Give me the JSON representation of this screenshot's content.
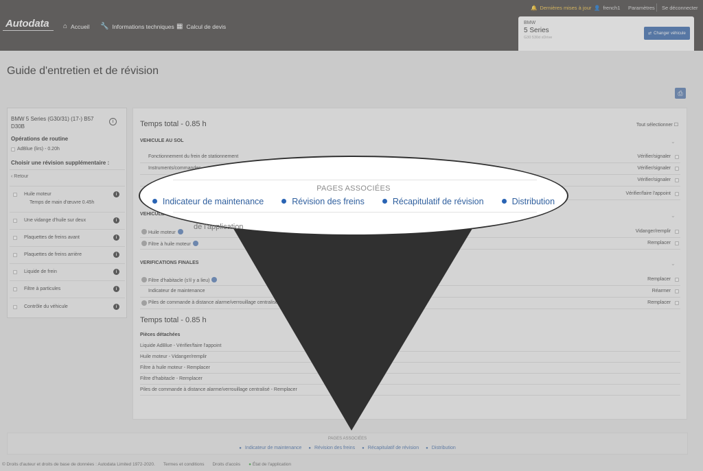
{
  "header": {
    "brand": "Autodata",
    "nav": [
      {
        "label": "Accueil",
        "icon": "home-icon"
      },
      {
        "label": "Informations techniques",
        "icon": "wrench-icon"
      },
      {
        "label": "Calcul de devis",
        "icon": "calculator-icon"
      }
    ],
    "updates": "Dernières mises à jour",
    "user": "french1",
    "settings": "Paramètres",
    "logout": "Se déconnecter"
  },
  "vehicle": {
    "make": "BMW",
    "model": "5 Series",
    "sub": "G30 530d xDrive",
    "change_label": "Changer véhicule"
  },
  "page": {
    "title": "Guide d'entretien et de révision"
  },
  "sidebar": {
    "vehicle": "BMW 5 Series (G30/31) (17-) B57 D30B",
    "routine_heading": "Opérations de routine",
    "routine_item": "AdBlue (lirs) - 0.20h",
    "extra_heading": "Choisir une révision supplémentaire :",
    "back": "Retour",
    "items": [
      {
        "label": "Huile moteur",
        "detail": "Temps de main d'œuvre 0.45h"
      },
      {
        "label": "Une vidange d'huile sur deux"
      },
      {
        "label": "Plaquettes de freins avant"
      },
      {
        "label": "Plaquettes de freins arrière"
      },
      {
        "label": "Liquide de frein"
      },
      {
        "label": "Filtre à particules"
      },
      {
        "label": "Contrôle du véhicule"
      }
    ]
  },
  "main": {
    "total_top": "Temps total - 0.85 h",
    "select_all": "Tout sélectionner",
    "sections": [
      {
        "title": "VEHICULE AU SOL",
        "rows": [
          {
            "label": "Fonctionnement du frein de stationnement",
            "action": "Vérifier/signaler"
          },
          {
            "label": "Instruments/commandes",
            "action": "Vérifier/signaler"
          },
          {
            "label": "",
            "action": "Vérifier/signaler"
          },
          {
            "label": "",
            "action": "Vérifier/faire l'appoint"
          }
        ]
      },
      {
        "title": "VEHICULE",
        "rows": [
          {
            "label": "Huile moteur",
            "action": "Vidanger/remplir"
          },
          {
            "label": "Filtre à huile moteur",
            "action": "Remplacer"
          }
        ]
      },
      {
        "title": "VERIFICATIONS FINALES",
        "rows": [
          {
            "label": "Filtre d'habitacle (s'il y a lieu)",
            "action": "Remplacer"
          },
          {
            "label": "Indicateur de maintenance",
            "action": "Réarmer"
          },
          {
            "label": "Piles de commande à distance alarme/verrouillage centralisé",
            "action": "Remplacer"
          }
        ]
      }
    ],
    "total_bottom": "Temps total - 0.85 h",
    "parts_heading": "Pièces détachées",
    "parts": [
      "Liquide AdBlue - Vérifier/faire l'appoint",
      "Huile moteur - Vidanger/remplir",
      "Filtre à huile moteur - Remplacer",
      "Filtre d'habitacle - Remplacer",
      "Piles de commande à distance alarme/verrouillage centralisé - Remplacer"
    ],
    "ghost_text": "de l'application"
  },
  "related": {
    "title": "PAGES ASSOCIÉES",
    "links": [
      "Indicateur de maintenance",
      "Révision des freins",
      "Récapitulatif de révision",
      "Distribution"
    ]
  },
  "footer": {
    "copyright": "© Droits d'auteur et droits de base de données : Autodata Limited 1972-2020.",
    "terms": "Termes et conditions",
    "rights": "Droits d'accès",
    "status": "État de l'application"
  },
  "colors": {
    "accent": "#2a64b4",
    "header": "#4b4846",
    "updates": "#f3c54a"
  }
}
